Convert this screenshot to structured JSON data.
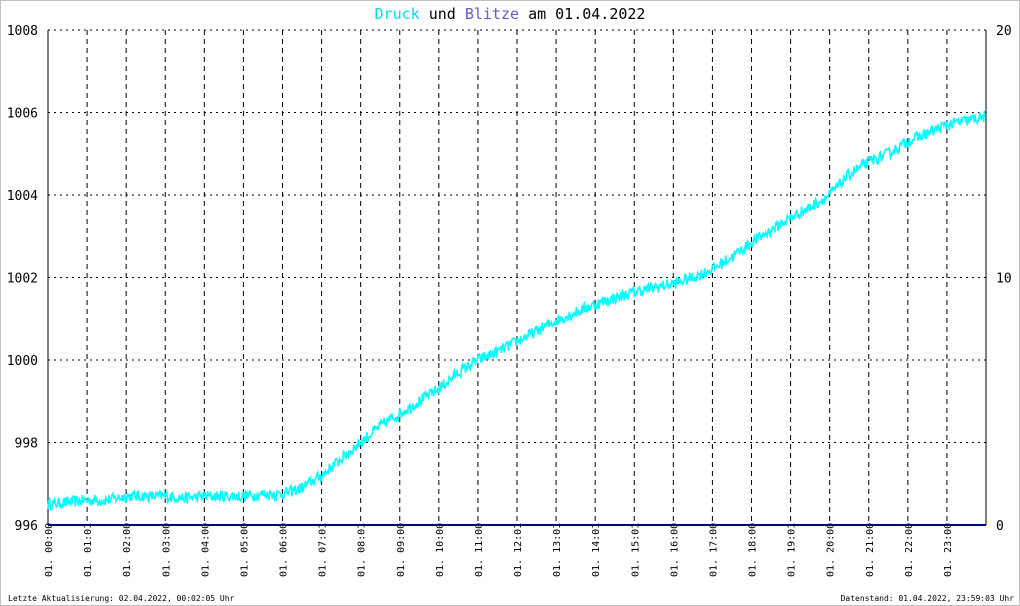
{
  "title": {
    "series1": "Druck",
    "connector": "und",
    "series2": "Blitze",
    "date_prefix": "am",
    "date": "01.04.2022"
  },
  "footer": {
    "last_update": "Letzte Aktualisierung: 02.04.2022, 00:02:05 Uhr",
    "data_status": "Datenstand: 01.04.2022, 23:59:03 Uhr"
  },
  "colors": {
    "pressure": "#00ffff",
    "lightning": "#000080",
    "grid": "#000000",
    "title_druck": "#00e0e0",
    "title_blitze": "#6060c0"
  },
  "chart_data": {
    "type": "line",
    "grid": true,
    "left_axis": {
      "ylim": [
        996,
        1008
      ],
      "ticks": [
        "996",
        "998",
        "1000",
        "1002",
        "1004",
        "1006",
        "1008"
      ]
    },
    "right_axis": {
      "ylim": [
        0,
        20
      ],
      "ticks": [
        "0",
        "10",
        "20"
      ]
    },
    "x_range_hours": [
      0,
      24
    ],
    "x_ticks": [
      "01. 00:00",
      "01. 01:01",
      "01. 02:00",
      "01. 03:00",
      "01. 04:00",
      "01. 05:00",
      "01. 06:00",
      "01. 07:01",
      "01. 08:01",
      "01. 09:00",
      "01. 10:00",
      "01. 11:00",
      "01. 12:01",
      "01. 13:01",
      "01. 14:01",
      "01. 15:01",
      "01. 16:00",
      "01. 17:00",
      "01. 18:00",
      "01. 19:01",
      "01. 20:00",
      "01. 21:00",
      "01. 22:00",
      "01. 23:00"
    ],
    "series": [
      {
        "name": "Druck",
        "axis": "left",
        "x": [
          0,
          0.5,
          1,
          1.5,
          2,
          2.5,
          3,
          3.5,
          4,
          4.5,
          5,
          5.5,
          6,
          6.5,
          7,
          7.5,
          8,
          8.5,
          9,
          9.5,
          10,
          10.5,
          11,
          11.5,
          12,
          12.5,
          13,
          13.5,
          14,
          14.5,
          15,
          15.5,
          16,
          16.5,
          17,
          17.5,
          18,
          18.5,
          19,
          19.5,
          20,
          20.5,
          21,
          21.5,
          22,
          22.5,
          23,
          23.5,
          23.98
        ],
        "values": [
          996.5,
          996.55,
          996.6,
          996.6,
          996.7,
          996.7,
          996.7,
          996.65,
          996.7,
          996.7,
          996.7,
          996.75,
          996.75,
          996.9,
          997.2,
          997.6,
          998.0,
          998.4,
          998.7,
          999.0,
          999.3,
          999.7,
          1000.0,
          1000.2,
          1000.45,
          1000.7,
          1000.95,
          1001.15,
          1001.35,
          1001.5,
          1001.65,
          1001.75,
          1001.85,
          1002.0,
          1002.2,
          1002.5,
          1002.85,
          1003.15,
          1003.45,
          1003.7,
          1004.0,
          1004.5,
          1004.8,
          1005.0,
          1005.3,
          1005.5,
          1005.7,
          1005.8,
          1005.9
        ]
      },
      {
        "name": "Blitze",
        "axis": "right",
        "x": [
          0,
          24
        ],
        "values": [
          0,
          0
        ]
      }
    ]
  }
}
